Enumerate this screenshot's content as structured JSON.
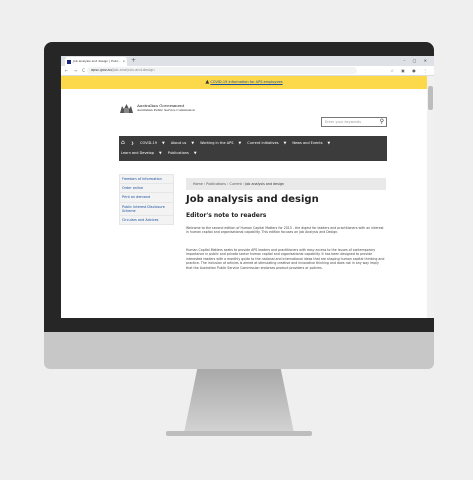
{
  "browser": {
    "tab_title": "Job analysis and design | Publ...",
    "tab_close": "×",
    "new_tab": "+",
    "window_controls": "–  ▢  ✕",
    "nav_buttons": "←  →  C",
    "url_domain": "apsc.gov.au",
    "url_path": "/job-analysis-and-design",
    "extensions": "☆  ▣  ●  ⋮"
  },
  "alert": {
    "icon": "warning-icon",
    "text": "COVID-19 information for APS employees"
  },
  "header": {
    "gov_name": "Australian Government",
    "agency_name": "Australian Public Service Commission",
    "search_placeholder": "Enter your keywords"
  },
  "nav": {
    "home_icon": "home-icon",
    "items": [
      {
        "label": "COVID-19"
      },
      {
        "label": "About us"
      },
      {
        "label": "Working in the APS"
      },
      {
        "label": "Current initiatives"
      },
      {
        "label": "News and Events"
      },
      {
        "label": "Learn and Develop"
      },
      {
        "label": "Publications"
      }
    ]
  },
  "sidebar": {
    "items": [
      {
        "label": "Freedom of Information"
      },
      {
        "label": "Order online"
      },
      {
        "label": "Print on demand"
      },
      {
        "label": "Public Interest Disclosure Scheme"
      },
      {
        "label": "Circulars and Advices"
      }
    ]
  },
  "breadcrumb": {
    "home": "Home",
    "publications": "Publications",
    "current": "Current",
    "page": "Job analysis and design",
    "separator": "›"
  },
  "main": {
    "title": "Job analysis and design",
    "subtitle": "Editor's note to readers",
    "para1": "Welcome to the second edition of Human Capital Matters for 2015 - the digest for leaders and practitioners with an interest in human capital and organisational capability. This edition focuses on Job Analysis and Design.",
    "para2": "Human Capital Matters seeks to provide APS leaders and practitioners with easy access to the issues of contemporary importance in public and private sector human capital and organisational capability. It has been designed to provide interested readers with a monthly guide to the national and international ideas that are shaping human capital thinking and practice. The inclusion of articles is aimed at stimulating creative and innovative thinking and does not in any way imply that the Australian Public Service Commission endorses product providers or policies."
  }
}
